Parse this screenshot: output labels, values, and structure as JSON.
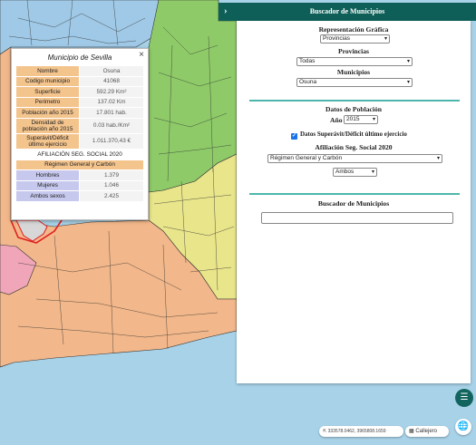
{
  "popup": {
    "title": "Municipio de Sevilla",
    "close_icon": "close-icon",
    "rows": [
      {
        "key": "Nombre",
        "value": "Osuna"
      },
      {
        "key": "Codigo municipio",
        "value": "41068"
      },
      {
        "key": "Superficie",
        "value": "592.29 Km²"
      },
      {
        "key": "Perimetro",
        "value": "137.02 Km"
      },
      {
        "key": "Población año 2015",
        "value": "17.801 hab."
      },
      {
        "key": "Densidad de población año 2015",
        "value": "0.03 hab./Km²"
      },
      {
        "key": "Superávit/Déficit último ejercicio",
        "value": "1.011.370,43 €"
      }
    ],
    "affil_title": "AFILIACIÓN SEG. SOCIAL 2020",
    "regime_title": "Régimen General y Carbón",
    "affil_rows": [
      {
        "key": "Hombres",
        "value": "1.379"
      },
      {
        "key": "Mujeres",
        "value": "1.046"
      },
      {
        "key": "Ambos sexos",
        "value": "2.425"
      }
    ]
  },
  "panel": {
    "header_title": "Buscador de Municipios",
    "chevron_icon": "chevron-right-icon",
    "rep_label": "Representación Gráfica",
    "rep_value": "Provincias",
    "prov_label": "Provincias",
    "prov_value": "Todas",
    "mun_label": "Municipios",
    "mun_value": "Osuna",
    "pop_label": "Datos de Población",
    "year_label": "Año",
    "year_value": "2015",
    "check_label": "Datos Superávit/Déficit último ejercicio",
    "check_checked": true,
    "affil_label": "Afiliación Seg. Social 2020",
    "regime_value": "Régimen General y Carbón",
    "sex_value": "Ambos",
    "search_label": "Buscador de Municipios",
    "search_value": ""
  },
  "controls": {
    "layers_icon": "layers-icon",
    "coords": "333578.0462, 3965808.1659",
    "callejero_label": "Callejero",
    "globe_icon": "globe-icon"
  },
  "colors": {
    "header": "#0e5f58",
    "separator": "#4db6ac",
    "sevilla_fill": "#f2b78a",
    "granada_fill": "#e8e58a",
    "cordoba_fill": "#8ecb68",
    "jaen_fill": "#9fc9e6",
    "selected_fill": "#d7d7d7",
    "sea": "#a8d2e8"
  }
}
